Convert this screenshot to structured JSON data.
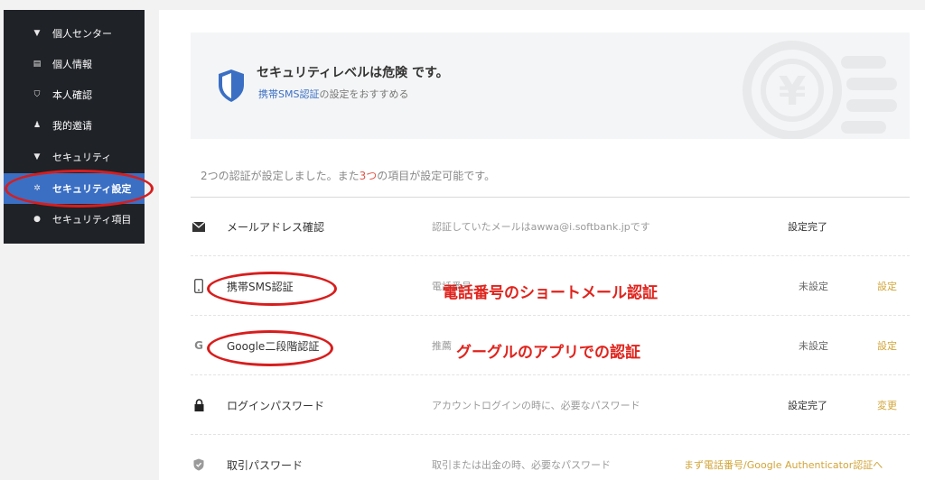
{
  "sidebar": {
    "items": [
      {
        "label": "個人センター",
        "icon": "caret-down-icon",
        "glyph": "▼"
      },
      {
        "label": "個人情報",
        "icon": "id-card-icon",
        "glyph": "▤"
      },
      {
        "label": "本人確認",
        "icon": "shield-icon",
        "glyph": "⛉"
      },
      {
        "label": "我的邀请",
        "icon": "user-icon",
        "glyph": "♟"
      },
      {
        "label": "セキュリティ",
        "icon": "caret-down-icon",
        "glyph": "▼"
      },
      {
        "label": "セキュリティ設定",
        "icon": "gear-icon",
        "glyph": "✲"
      },
      {
        "label": "セキュリティ項目",
        "icon": "bulb-icon",
        "glyph": "●"
      }
    ]
  },
  "banner": {
    "title_prefix": "セキュリティレベルは",
    "level": "危険",
    "title_suffix": " です。",
    "sub_link": "携帯SMS認証",
    "sub_text": "の設定をおすすめる"
  },
  "summary": {
    "part1": "2つの認証が設定しました。また",
    "count": "3つ",
    "part2": "の項目が設定可能です。"
  },
  "rows": [
    {
      "name": "メールアドレス確認",
      "desc": "認証していたメールはawwa@i.softbank.jpです",
      "status": "設定完了",
      "action": ""
    },
    {
      "name": "携帯SMS認証",
      "desc": "電話番号",
      "status": "未設定",
      "action": "設定"
    },
    {
      "name": "Google二段階認証",
      "desc": "推薦",
      "status": "未設定",
      "action": "設定"
    },
    {
      "name": "ログインパスワード",
      "desc": "アカウントログインの時に、必要なパスワード",
      "status": "設定完了",
      "action": "変更"
    },
    {
      "name": "取引パスワード",
      "desc": "取引または出金の時、必要なパスワード",
      "status": "まず電話番号/Google Authenticator認証へ",
      "action": ""
    }
  ],
  "annotations": {
    "sms_note": "電話番号のショートメール認証",
    "google_note": "グーグルのアプリでの認証"
  },
  "colors": {
    "sidebar_bg": "#1f2227",
    "active_bg": "#3a6fc4",
    "action": "#d2a53a",
    "annotation": "#d81d1d"
  }
}
